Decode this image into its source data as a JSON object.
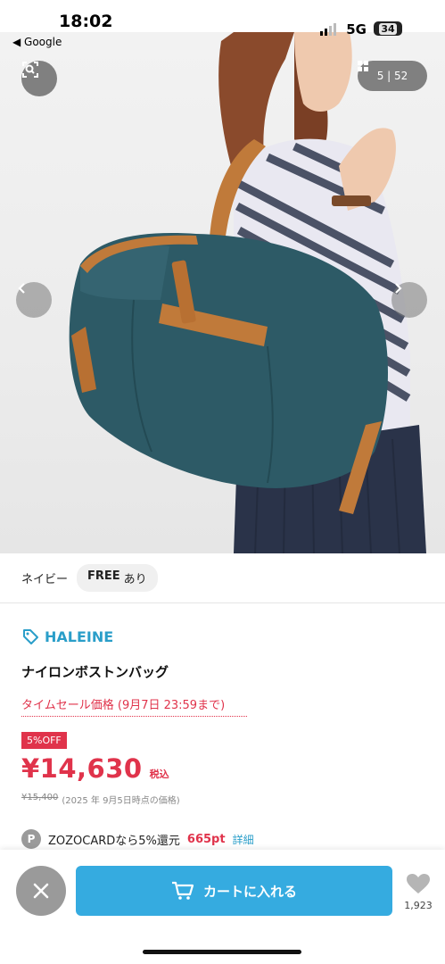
{
  "status_bar": {
    "time": "18:02",
    "back_label": "◀ Google",
    "network": "5G",
    "battery": "34"
  },
  "gallery": {
    "counter": "5 | 52",
    "icons": {
      "zoom": "image-search-icon",
      "grid": "grid-icon",
      "prev": "chevron-left-icon",
      "next": "chevron-right-icon"
    }
  },
  "variant": {
    "color": "ネイビー",
    "size": "FREE",
    "stock": "あり"
  },
  "product": {
    "brand": "HALEINE",
    "name": "ナイロンボストンバッグ",
    "sale_label": "タイムセール価格 (9月7日 23:59まで)",
    "discount_badge": "5%OFF",
    "price": "¥14,630",
    "tax_label": "税込",
    "original_price": "¥15,400",
    "original_note": "(2025 年 9月5日時点の価格)"
  },
  "points": {
    "icon_letter": "P",
    "text": "ZOZOCARDなら5%還元",
    "amount": "665pt",
    "link": "詳細"
  },
  "bottom_bar": {
    "cart_label": "カートに入れる",
    "favorite_count": "1,923"
  },
  "colors": {
    "accent_blue": "#35abe0",
    "brand_blue": "#2a9ec9",
    "sale_red": "#e0334b",
    "bag_teal": "#2d5a66",
    "leather_tan": "#c07a3a"
  }
}
